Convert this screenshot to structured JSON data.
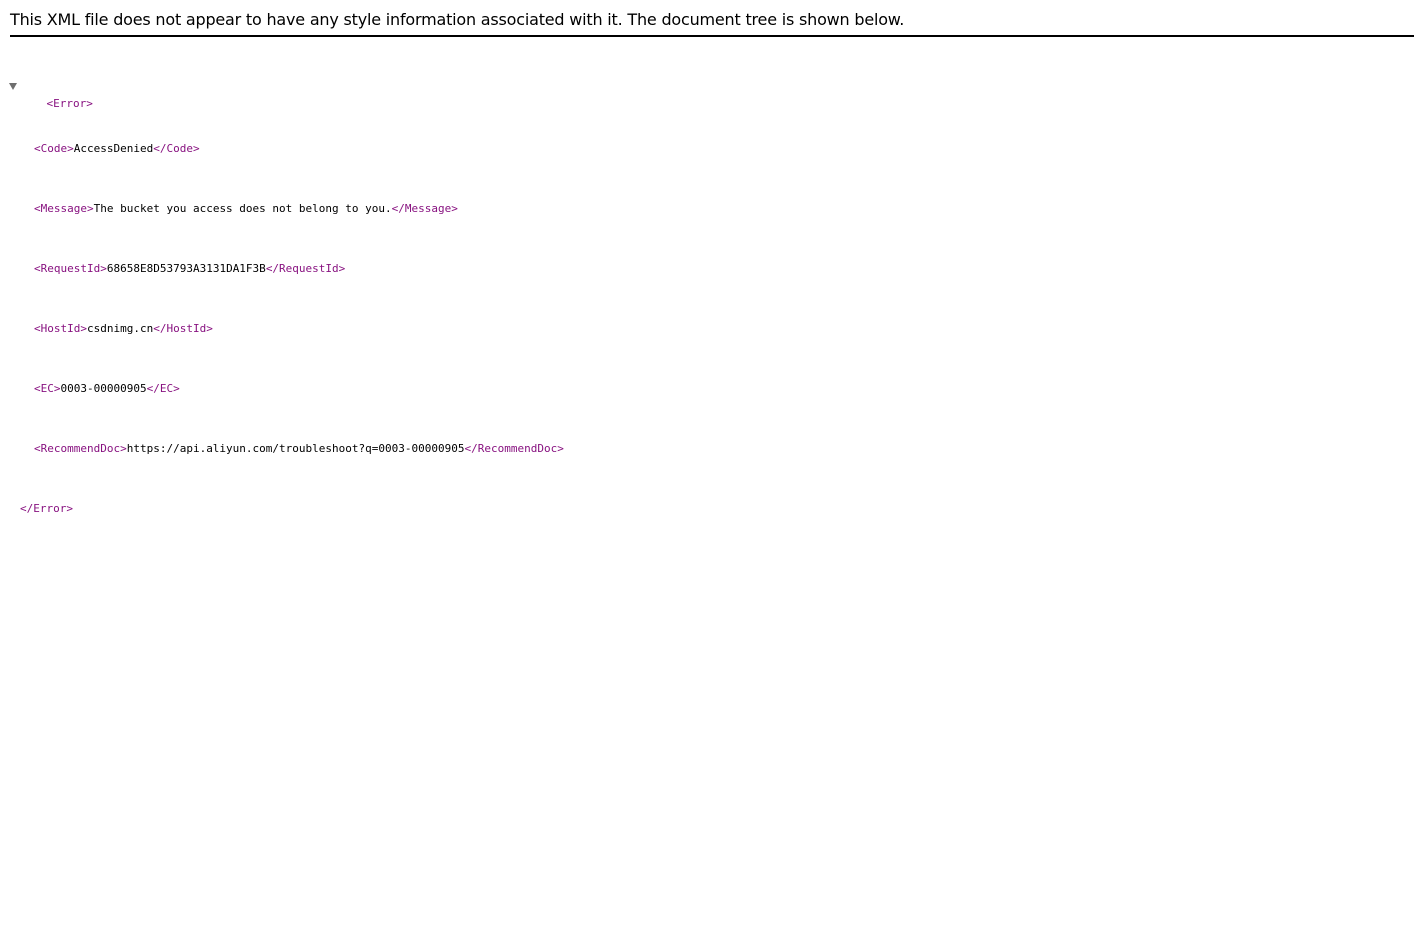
{
  "header": {
    "message": "This XML file does not appear to have any style information associated with it. The document tree is shown below."
  },
  "tree": {
    "root_open": "<Error>",
    "root_close": "</Error>",
    "children": [
      {
        "open": "<Code>",
        "value": "AccessDenied",
        "close": "</Code>"
      },
      {
        "open": "<Message>",
        "value": "The bucket you access does not belong to you.",
        "close": "</Message>"
      },
      {
        "open": "<RequestId>",
        "value": "68658E8D53793A3131DA1F3B",
        "close": "</RequestId>"
      },
      {
        "open": "<HostId>",
        "value": "csdnimg.cn",
        "close": "</HostId>"
      },
      {
        "open": "<EC>",
        "value": "0003-00000905",
        "close": "</EC>"
      },
      {
        "open": "<RecommendDoc>",
        "value": "https://api.aliyun.com/troubleshoot?q=0003-00000905",
        "close": "</RecommendDoc>"
      }
    ]
  },
  "colors": {
    "tag": "#881280",
    "text": "#000000",
    "toggle": "#6e6e6e"
  },
  "icons": {
    "toggle": "collapse-triangle-icon"
  }
}
